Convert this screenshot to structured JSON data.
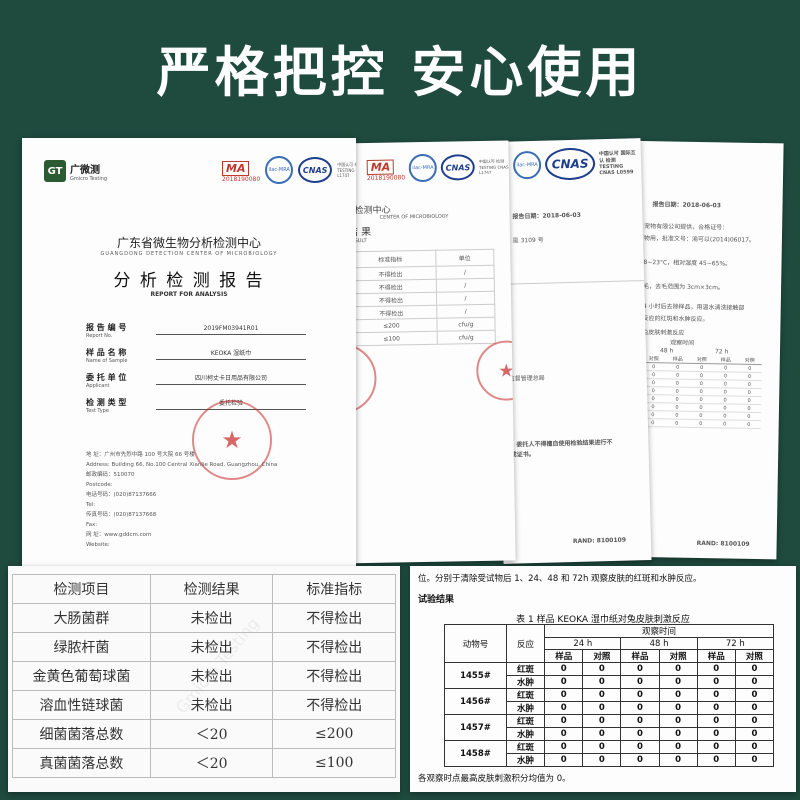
{
  "headline": "严格把控   安心使用",
  "report1": {
    "logo_mark": "GT",
    "logo_name": "广微测",
    "logo_en": "Gmicro Testing",
    "cma": "MA",
    "cma_num": "2018190080",
    "ilac": "ilac-MRA",
    "cnas": "CNAS",
    "cnas_side": "中国认可 检测 TESTING CNAS L1747",
    "org_zh": "广东省微生物分析检测中心",
    "org_en": "GUANGDONG DETECTION CENTER OF MICROBIOLOGY",
    "title_zh": "分 析 检 测 报 告",
    "title_en": "REPORT  FOR  ANALYSIS",
    "fields": [
      {
        "zh": "报 告 编 号",
        "en": "Report No.",
        "value": "2019FM03941R01"
      },
      {
        "zh": "样 品 名 称",
        "en": "Name of Sample",
        "value": "KEOKA 湿纸巾"
      },
      {
        "zh": "委 托 单 位",
        "en": "Applicant",
        "value": "四川柯丈卡日用品有限公司"
      },
      {
        "zh": "检 测 类 型",
        "en": "Test Type",
        "value": "委托检验"
      }
    ],
    "stamp": "★",
    "address": [
      "地 址：广州市先烈中路 100 号大院 66 号楼",
      "Address: Building 66, No.100 Central Xianlie Road, Guangzhou, China",
      "邮政编码：510070",
      "Postcode:",
      "电话号码：(020)87137666",
      "Tel:",
      "传真号码：(020)87137668",
      "Fax:",
      "网 址：www.gddcm.com",
      "Website:"
    ]
  },
  "report2": {
    "cma": "MA",
    "cma_num": "2018190080",
    "ilac": "ilac-MRA",
    "cnas": "CNAS",
    "cnas_side": "中国认可 检测 TESTING CNAS L1747",
    "org": "析检测中心",
    "org_en": "CENTER OF MICROBIOLOGY",
    "result": "结 果",
    "result_en": "RESULT",
    "col1": "标准指标",
    "col2": "单位",
    "rows": [
      {
        "a": "不得检出",
        "b": "/"
      },
      {
        "a": "不得检出",
        "b": "/"
      },
      {
        "a": "不得检出",
        "b": "/"
      },
      {
        "a": "不得检出",
        "b": "/"
      },
      {
        "a": "≤200",
        "b": "cfu/g"
      },
      {
        "a": "≤100",
        "b": "cfu/g"
      }
    ]
  },
  "report3": {
    "ilac": "ilac-MRA",
    "cnas": "CNAS",
    "cnas_side": "中国认可 国际互认 检测 TESTING CNAS L0599",
    "date": "报告日期：2018-06-03",
    "code": "31 是 3109 号",
    "auth": "品监督管理总局",
    "note1": "图、委托人不得擅自使用检验结果进行不",
    "note2": "造成证书。",
    "rand": "RAND: 8100109"
  },
  "report4": {
    "date": "报告日期：2018-06-03",
    "l1": "宠物有限公司提供，合格证号：",
    "l2": "物用，批准文号：渝可以(2014)06017。",
    "l3": "8~23°C，相对湿度 45~65%。",
    "l4": "毛，去毛范围为 3cm×3cm。",
    "l5": "4 小时后去除样品，用温水清洗接触部",
    "l6": "反应的红斑和水肿反应。",
    "t_head": "兔皮肤刺激反应",
    "t_time": "观察时间",
    "t_h1": "48 h",
    "t_h2": "72 h",
    "t_sub": [
      "对照",
      "样品",
      "对照",
      "样品",
      "对照"
    ],
    "rand": "RAND: 8100109"
  },
  "table_left": {
    "headers": [
      "检测项目",
      "检测结果",
      "标准指标"
    ],
    "rows": [
      [
        "大肠菌群",
        "未检出",
        "不得检出"
      ],
      [
        "绿脓杆菌",
        "未检出",
        "不得检出"
      ],
      [
        "金黄色葡萄球菌",
        "未检出",
        "不得检出"
      ],
      [
        "溶血性链球菌",
        "未检出",
        "不得检出"
      ],
      [
        "细菌菌落总数",
        "＜20",
        "≤200"
      ],
      [
        "真菌菌落总数",
        "＜20",
        "≤100"
      ]
    ],
    "watermark": "Gmicro Testing"
  },
  "table_right": {
    "intro": "位。分别于清除受试物后 1、24、48 和 72h 观察皮肤的红斑和水肿反应。",
    "section": "试验结果",
    "caption": "表 1  样品 KEOKA 湿巾纸对兔皮肤刺激反应",
    "h_animal": "动物号",
    "h_reaction": "反应",
    "h_time": "观察时间",
    "times": [
      "24 h",
      "48 h",
      "72 h"
    ],
    "sub": [
      "样品",
      "对照",
      "样品",
      "对照",
      "样品",
      "对照"
    ],
    "animals": [
      {
        "id": "1455#",
        "rows": [
          {
            "r": "红斑",
            "v": [
              "0",
              "0",
              "0",
              "0",
              "0",
              "0"
            ]
          },
          {
            "r": "水肿",
            "v": [
              "0",
              "0",
              "0",
              "0",
              "0",
              "0"
            ]
          }
        ]
      },
      {
        "id": "1456#",
        "rows": [
          {
            "r": "红斑",
            "v": [
              "0",
              "0",
              "0",
              "0",
              "0",
              "0"
            ]
          },
          {
            "r": "水肿",
            "v": [
              "0",
              "0",
              "0",
              "0",
              "0",
              "0"
            ]
          }
        ]
      },
      {
        "id": "1457#",
        "rows": [
          {
            "r": "红斑",
            "v": [
              "0",
              "0",
              "0",
              "0",
              "0",
              "0"
            ]
          },
          {
            "r": "水肿",
            "v": [
              "0",
              "0",
              "0",
              "0",
              "0",
              "0"
            ]
          }
        ]
      },
      {
        "id": "1458#",
        "rows": [
          {
            "r": "红斑",
            "v": [
              "0",
              "0",
              "0",
              "0",
              "0",
              "0"
            ]
          },
          {
            "r": "水肿",
            "v": [
              "0",
              "0",
              "0",
              "0",
              "0",
              "0"
            ]
          }
        ]
      }
    ],
    "footer": "各观察时点最高皮肤刺激积分均值为 0。"
  }
}
